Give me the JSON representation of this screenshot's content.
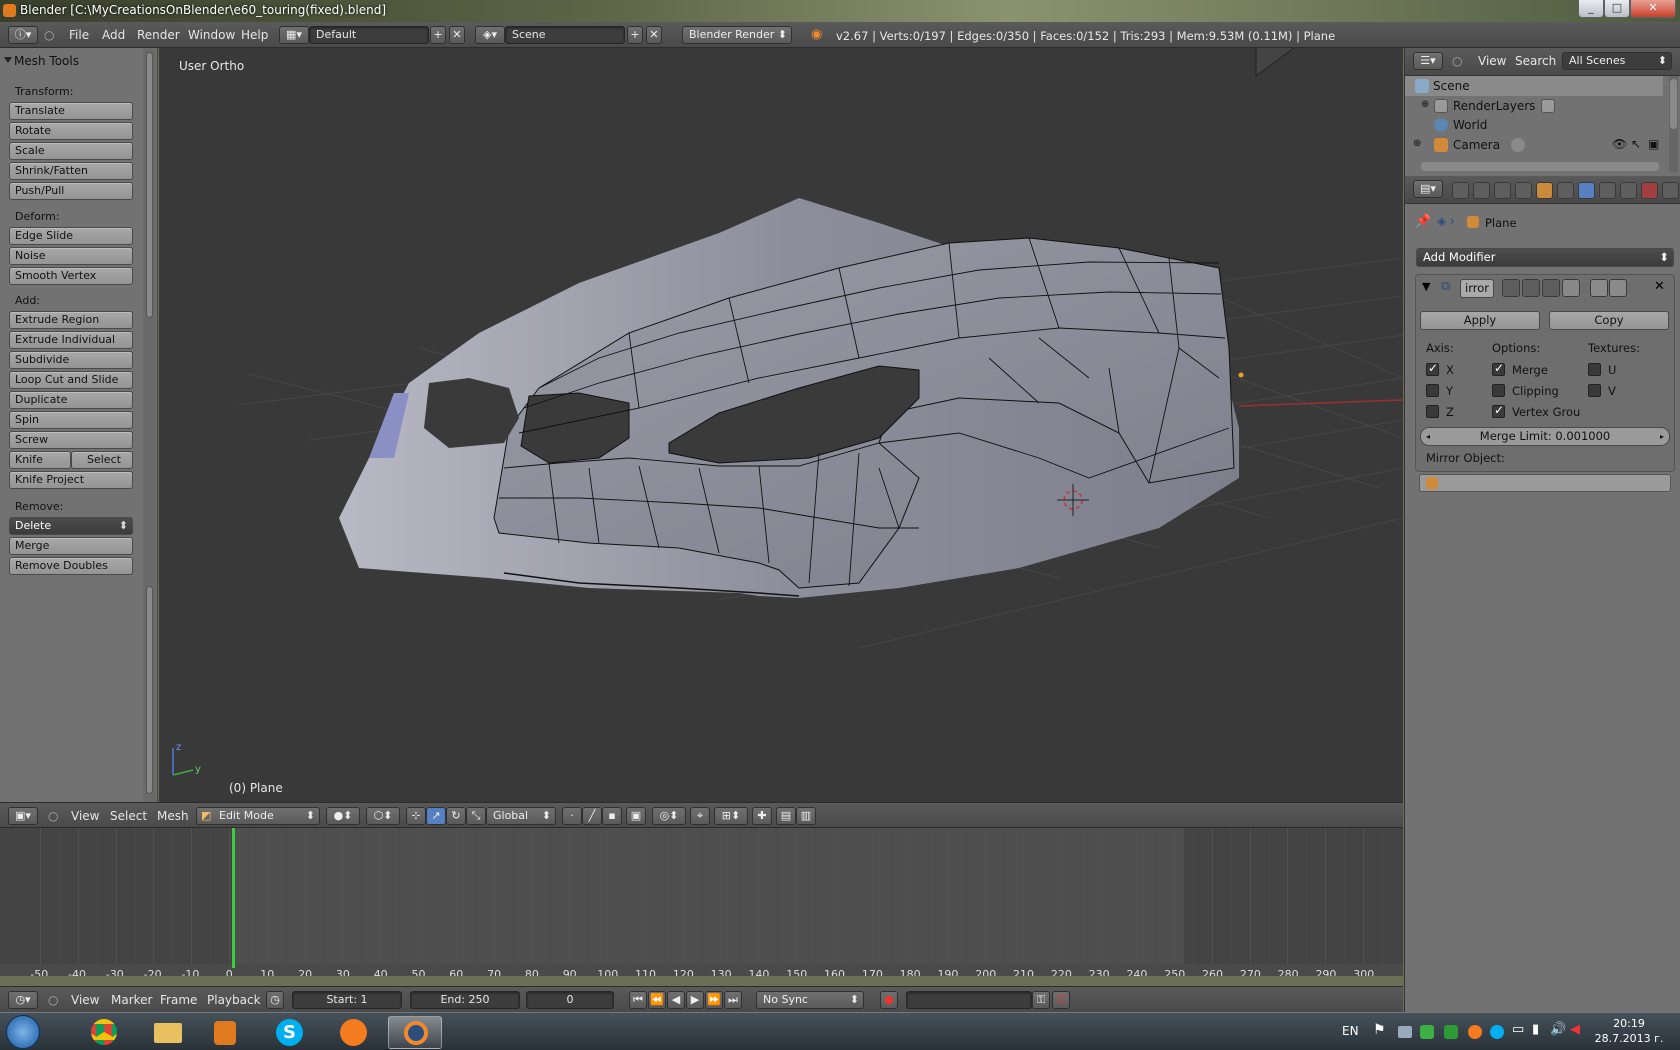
{
  "window": {
    "title": "Blender  [C:\\MyCreationsOnBlender\\e60_touring(fixed).blend]",
    "minimize": "_",
    "maximize": "□",
    "close": "✕"
  },
  "top_header": {
    "menus": [
      "File",
      "Add",
      "Render",
      "Window",
      "Help"
    ],
    "layout": "Default",
    "scene": "Scene",
    "engine": "Blender Render",
    "stats": "v2.67 | Verts:0/197 | Edges:0/350 | Faces:0/152 | Tris:293 | Mem:9.53M (0.11M) | Plane"
  },
  "tool_panel": {
    "title": "Mesh Tools",
    "transform_label": "Transform:",
    "transform": [
      "Translate",
      "Rotate",
      "Scale",
      "Shrink/Fatten",
      "Push/Pull"
    ],
    "deform_label": "Deform:",
    "deform": [
      "Edge Slide",
      "Noise",
      "Smooth Vertex"
    ],
    "add_label": "Add:",
    "add": [
      "Extrude Region",
      "Extrude Individual",
      "Subdivide",
      "Loop Cut and Slide",
      "Duplicate",
      "Spin",
      "Screw"
    ],
    "knife": "Knife",
    "knife_select": "Select",
    "knife_project": "Knife Project",
    "remove_label": "Remove:",
    "delete": "Delete",
    "merge": "Merge",
    "remove_doubles": "Remove Doubles"
  },
  "viewport": {
    "view_name": "User Ortho",
    "object_label": "(0) Plane",
    "axis_z": "z",
    "axis_y": "y"
  },
  "viewport_header": {
    "menus": [
      "View",
      "Select",
      "Mesh"
    ],
    "mode": "Edit Mode",
    "orientation": "Global"
  },
  "timeline": {
    "ticks": [
      "-50",
      "-40",
      "-30",
      "-20",
      "-10",
      "0",
      "10",
      "20",
      "30",
      "40",
      "50",
      "60",
      "70",
      "80",
      "90",
      "100",
      "110",
      "120",
      "130",
      "140",
      "150",
      "160",
      "170",
      "180",
      "190",
      "200",
      "210",
      "220",
      "230",
      "240",
      "250",
      "260",
      "270",
      "280",
      "290",
      "300"
    ]
  },
  "timeline_header": {
    "menus": [
      "View",
      "Marker",
      "Frame",
      "Playback"
    ],
    "start": "Start: 1",
    "end": "End: 250",
    "current": "0",
    "sync": "No Sync"
  },
  "outliner": {
    "menus": [
      "View",
      "Search"
    ],
    "filter": "All Scenes",
    "items": [
      "Scene",
      "RenderLayers",
      "World",
      "Camera"
    ]
  },
  "properties": {
    "breadcrumb": "Plane",
    "add_modifier": "Add Modifier",
    "modifier_name": "irror",
    "apply": "Apply",
    "copy": "Copy",
    "axis_label": "Axis:",
    "options_label": "Options:",
    "textures_label": "Textures:",
    "axis": [
      {
        "label": "X",
        "checked": true
      },
      {
        "label": "Y",
        "checked": false
      },
      {
        "label": "Z",
        "checked": false
      }
    ],
    "options": [
      {
        "label": "Merge",
        "checked": true
      },
      {
        "label": "Clipping",
        "checked": false
      },
      {
        "label": "Vertex Grou",
        "checked": true
      }
    ],
    "textures": [
      {
        "label": "U",
        "checked": false
      },
      {
        "label": "V",
        "checked": false
      }
    ],
    "merge_limit": "Merge Limit: 0.001000",
    "mirror_object_label": "Mirror Object:"
  },
  "taskbar": {
    "language": "EN",
    "time": "20:19",
    "date": "28.7.2013 г."
  },
  "colors": {
    "accent": "#5680c2",
    "timeline_cursor": "#3dcc3d",
    "mesh": "#8d8f9e"
  }
}
